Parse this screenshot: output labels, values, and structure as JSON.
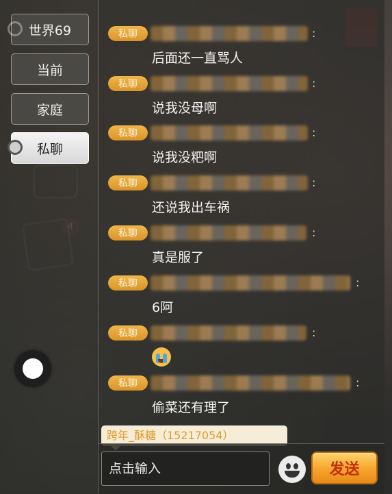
{
  "tabs": [
    {
      "label": "世界69",
      "active": false
    },
    {
      "label": "当前",
      "active": false
    },
    {
      "label": "家庭",
      "active": false
    },
    {
      "label": "私聊",
      "active": true
    }
  ],
  "background": {
    "badge_count": "4"
  },
  "messages": [
    {
      "tag": "私聊",
      "sender": "xxxxxxxxxxxxxx",
      "colon": ":",
      "text": "后面还一直骂人"
    },
    {
      "tag": "私聊",
      "sender": "xxxxxxxxxxxxxx",
      "colon": ":",
      "text": "说我没母啊"
    },
    {
      "tag": "私聊",
      "sender": "xxxxxxxxxxxxxx",
      "colon": ":",
      "text": "说我没粑啊"
    },
    {
      "tag": "私聊",
      "sender": "xxxxxxxxxxxxxx",
      "colon": ":",
      "text": "还说我出车祸"
    },
    {
      "tag": "私聊",
      "sender": "xxxxxxxxxxxxx",
      "colon": ":",
      "text": "真是服了"
    },
    {
      "tag": "私聊",
      "sender": "xxxxxxxxxxxxxxxxx",
      "colon": ":",
      "text": "6阿"
    },
    {
      "tag": "私聊",
      "sender": "xxxxxxxxxxxxx",
      "colon": ":",
      "text": "",
      "emoji": "crying-face"
    },
    {
      "tag": "私聊",
      "sender": "xxxxxxxxxxxxxxxxx",
      "colon": ":",
      "text": "偷菜还有理了"
    }
  ],
  "chat_target": "跨年_酥糖（15217054）",
  "input": {
    "placeholder": "点击输入",
    "value": ""
  },
  "send_label": "发送",
  "colors": {
    "accent": "#f0a830",
    "send_text": "#c0300a",
    "tag_bg": "#e6a23c"
  }
}
